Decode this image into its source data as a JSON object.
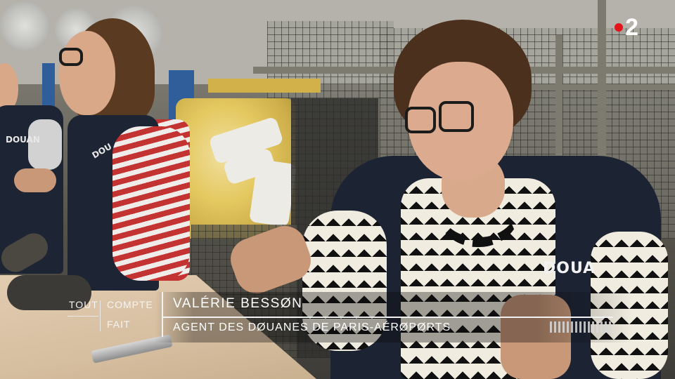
{
  "channel": {
    "logo_number": "2",
    "dot_color": "#e3141a"
  },
  "lower_third": {
    "show_title": {
      "word1": "TOUT",
      "word2": "COMPTE",
      "word3": "FAIT"
    },
    "name": "VALÉRIE BESSØN",
    "role": "AGENT DES DØUANES DE PARIS-AÉRØPØRTS"
  },
  "vest_labels": {
    "speaker": "DOUA",
    "left_worker": "DOUAN",
    "middle_worker": "DOU"
  }
}
